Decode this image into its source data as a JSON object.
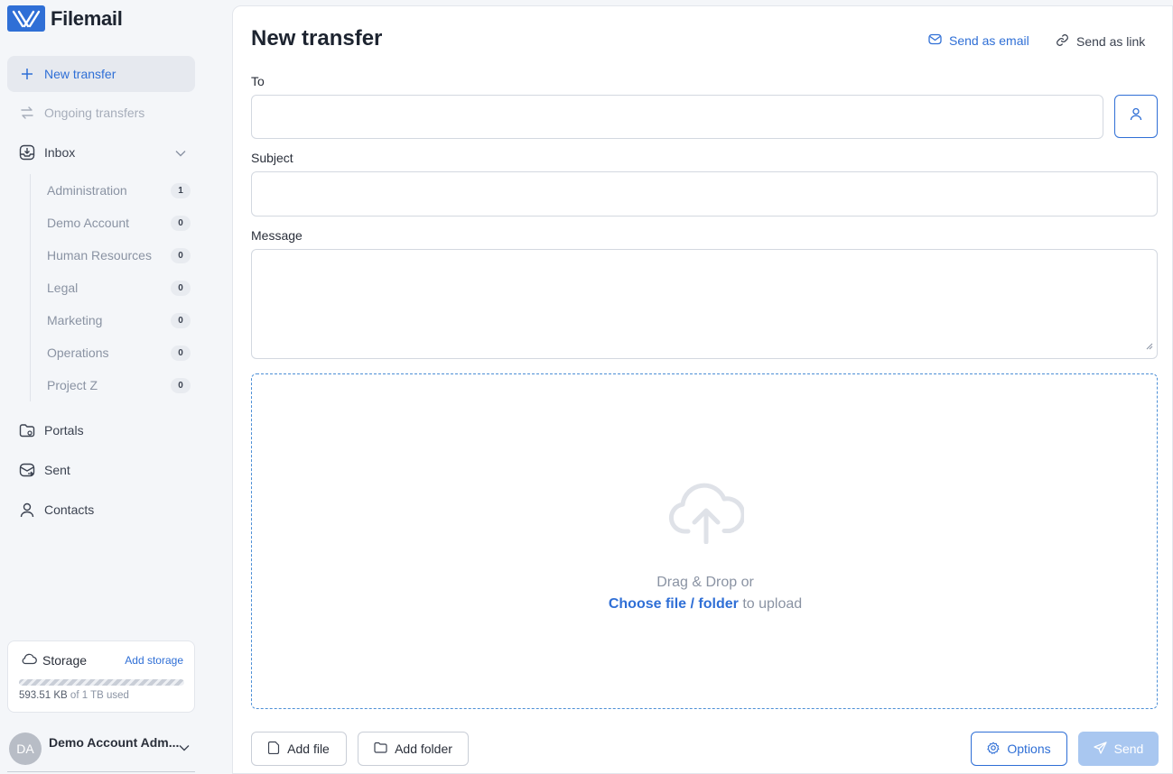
{
  "brand": {
    "name": "Filemail"
  },
  "sidebar": {
    "new_transfer": "New transfer",
    "ongoing_transfers": "Ongoing transfers",
    "inbox": "Inbox",
    "inbox_items": [
      {
        "label": "Administration",
        "count": "1"
      },
      {
        "label": "Demo Account",
        "count": "0"
      },
      {
        "label": "Human Resources",
        "count": "0"
      },
      {
        "label": "Legal",
        "count": "0"
      },
      {
        "label": "Marketing",
        "count": "0"
      },
      {
        "label": "Operations",
        "count": "0"
      },
      {
        "label": "Project Z",
        "count": "0"
      }
    ],
    "portals": "Portals",
    "sent": "Sent",
    "contacts": "Contacts",
    "storage": {
      "title": "Storage",
      "add_label": "Add storage",
      "used": "593.51 KB",
      "of_total": "of 1 TB used"
    },
    "account": {
      "initials": "DA",
      "name": "Demo Account Adm..."
    }
  },
  "main": {
    "title": "New transfer",
    "send_as_email": "Send as email",
    "send_as_link": "Send as link",
    "to_label": "To",
    "to_value": "",
    "subject_label": "Subject",
    "subject_value": "",
    "message_label": "Message",
    "message_value": "",
    "dropzone": {
      "line1": "Drag & Drop or",
      "choose_file": "Choose file",
      "separator": " / ",
      "folder": "folder",
      "suffix": " to upload"
    },
    "add_file": "Add file",
    "add_folder": "Add folder",
    "options": "Options",
    "send": "Send"
  },
  "colors": {
    "accent": "#2f6fd6",
    "send_disabled": "#a9c7f0",
    "muted": "#8a93a3"
  }
}
